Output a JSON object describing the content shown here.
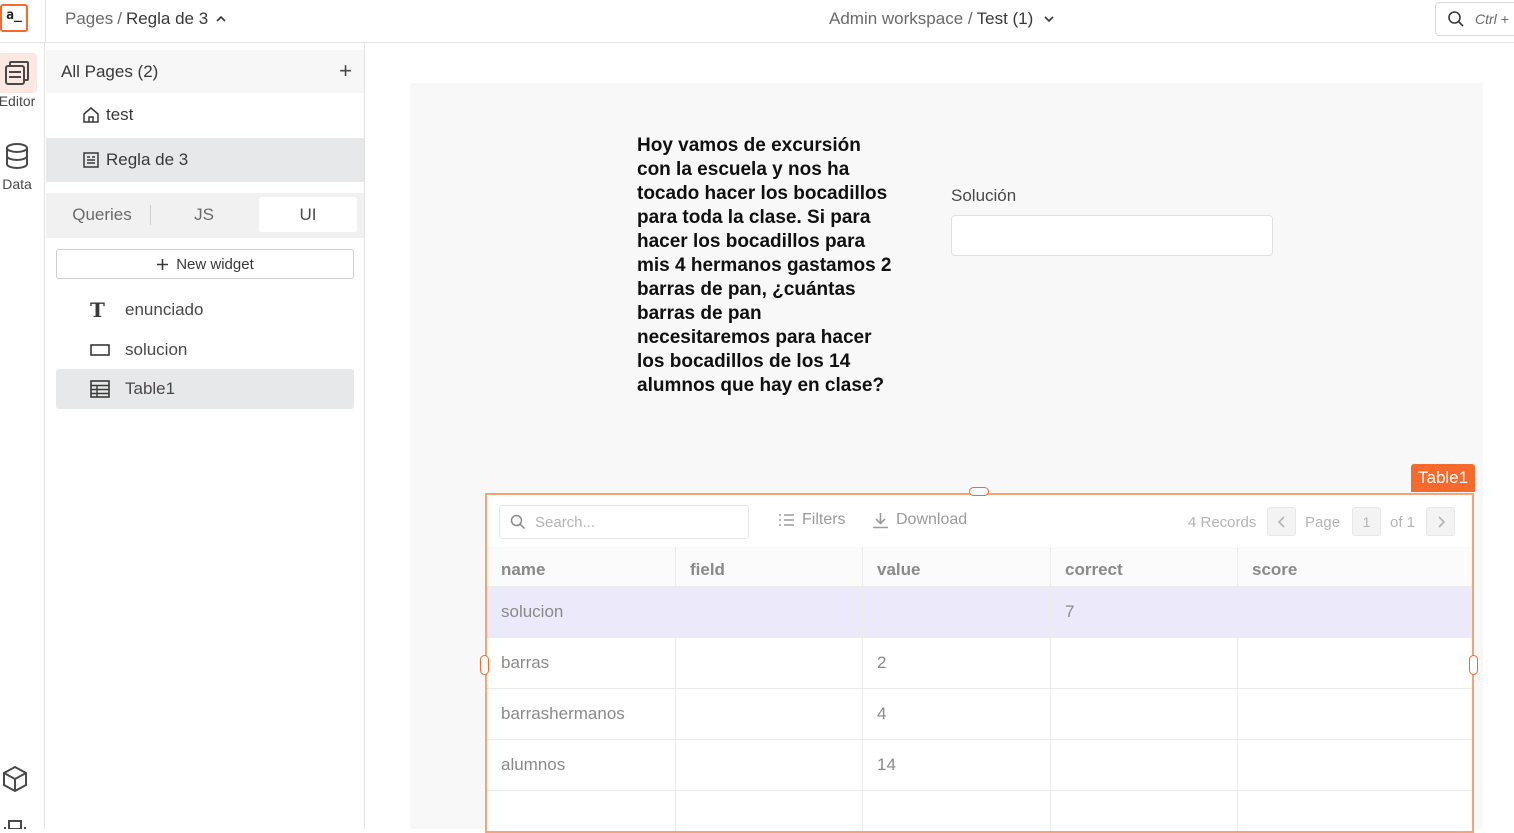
{
  "topbar": {
    "logo_text": "a_",
    "breadcrumb_root": "Pages",
    "breadcrumb_sep": "/",
    "breadcrumb_current": "Regla de 3",
    "workspace": "Admin workspace /",
    "app_name": "Test (1)",
    "search_shortcut": "Ctrl +"
  },
  "rail": {
    "editor_label": "Editor",
    "data_label": "Data"
  },
  "explorer": {
    "pages_header": "All Pages (2)",
    "add_icon": "+",
    "pages": [
      {
        "label": "test",
        "icon": "home-icon"
      },
      {
        "label": "Regla de 3",
        "icon": "page-icon"
      }
    ],
    "tabs": [
      "Queries",
      "JS",
      "UI"
    ],
    "new_widget_label": "New widget",
    "widgets": [
      {
        "label": "enunciado",
        "icon": "text-widget-icon"
      },
      {
        "label": "solucion",
        "icon": "input-widget-icon"
      },
      {
        "label": "Table1",
        "icon": "table-widget-icon"
      }
    ]
  },
  "canvas": {
    "enunciado_text": "Hoy vamos de excursión con la escuela y nos ha tocado hacer los bocadillos para toda la clase. Si para hacer los bocadillos para mis 4 hermanos gastamos 2 barras de pan, ¿cuántas barras de pan necesitaremos para hacer los bocadillos de los 14 alumnos que hay en clase?",
    "solution_label": "Solución",
    "solution_value": ""
  },
  "table": {
    "name_tag": "Table1",
    "search_placeholder": "Search...",
    "filters_label": "Filters",
    "download_label": "Download",
    "records_label": "4 Records",
    "page_label": "Page",
    "page_number": "1",
    "page_of": "of 1",
    "columns": [
      "name",
      "field",
      "value",
      "correct",
      "score"
    ],
    "rows": [
      [
        "solucion",
        "",
        "",
        "7",
        ""
      ],
      [
        "barras",
        "",
        "2",
        "",
        ""
      ],
      [
        "barrashermanos",
        "",
        "4",
        "",
        ""
      ],
      [
        "alumnos",
        "",
        "14",
        "",
        ""
      ]
    ],
    "accent_color": "#f86a2b",
    "selected_row_color": "#ebe9fa"
  }
}
